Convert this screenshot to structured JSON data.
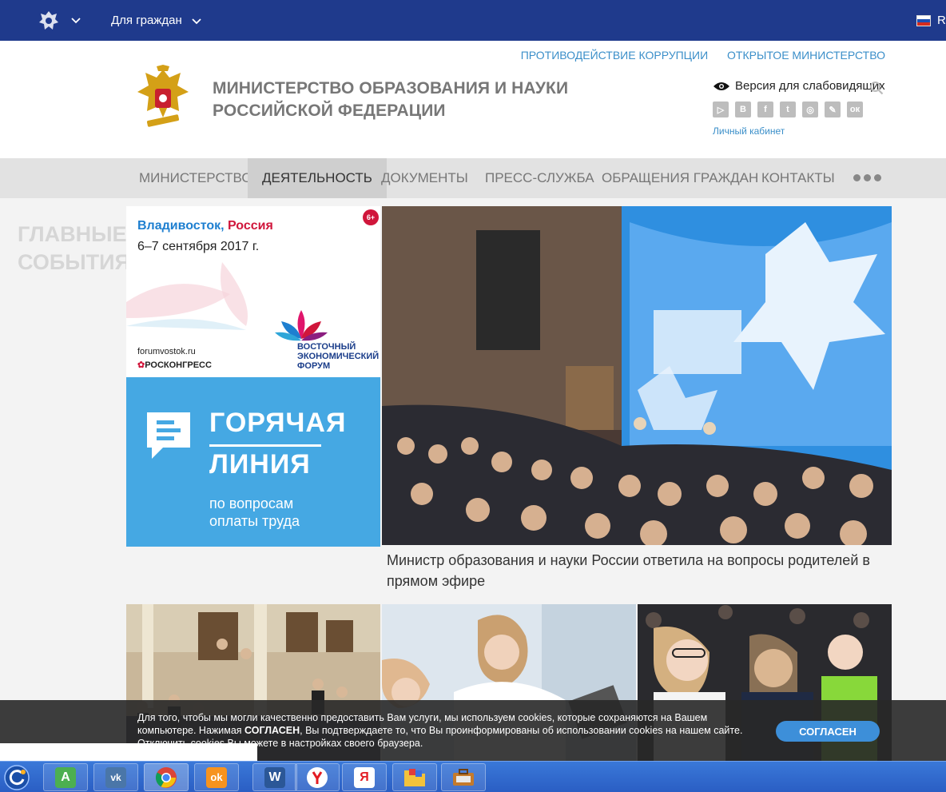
{
  "topbar": {
    "citizens_label": "Для граждан",
    "lang": "R"
  },
  "header": {
    "links": [
      "ПРОТИВОДЕЙСТВИЕ КОРРУПЦИИ",
      "ОТКРЫТОЕ МИНИСТЕРСТВО"
    ],
    "title_line1": "МИНИСТЕРСТВО ОБРАЗОВАНИЯ И НАУКИ",
    "title_line2": "РОССИЙСКОЙ ФЕДЕРАЦИИ",
    "vision_label": "Версия для слабовидящих",
    "socials": [
      "▷",
      "В",
      "f",
      "t",
      "◎",
      "✎",
      "ок"
    ],
    "cabinet_label": "Личный кабинет"
  },
  "nav": {
    "items": [
      "МИНИСТЕРСТВО",
      "ДЕЯТЕЛЬНОСТЬ",
      "ДОКУМЕНТЫ",
      "ПРЕСС-СЛУЖБА",
      "ОБРАЩЕНИЯ ГРАЖДАН",
      "КОНТАКТЫ"
    ],
    "active": "ДЕЯТЕЛЬНОСТЬ"
  },
  "side": {
    "line1": "ГЛАВНЫЕ",
    "line2": "СОБЫТИЯ"
  },
  "forum_banner": {
    "city_a": "Владивосток,",
    "city_b": "Россия",
    "dates": "6–7 сентября 2017 г.",
    "age": "6+",
    "site": "forumvostok.ru",
    "roscongress": "РОСКОНГРЕСС",
    "forum_l1": "ВОСТОЧНЫЙ",
    "forum_l2": "ЭКОНОМИЧЕСКИЙ",
    "forum_l3": "ФОРУМ"
  },
  "hotline_banner": {
    "l1": "ГОРЯЧАЯ",
    "l2": "ЛИНИЯ",
    "l3": "по вопросам",
    "l4": "оплаты труда"
  },
  "main_news": {
    "caption": "Министр образования и науки России ответила на вопросы родителей в прямом эфире"
  },
  "cookie": {
    "text_a": "Для того, чтобы мы могли качественно предоставить Вам услуги, мы используем cookies, которые сохраняются на Вашем компьютере. Нажимая ",
    "text_b": "СОГЛАСЕН",
    "text_c": ", Вы подтверждаете то, что Вы проинформированы об использовании cookies на нашем сайте. Отключить cookies Вы можете в настройках своего браузера.",
    "button": "СОГЛАСЕН"
  },
  "taskbar": {
    "apps": [
      "A",
      "vk",
      "chrome",
      "ok",
      "W",
      "Y",
      "Я",
      "folder",
      "briefcase"
    ],
    "colors": {
      "android": "#4caf50",
      "vk": "#4a76a8",
      "ok": "#f7931e",
      "word": "#2b5797",
      "yandex": "#ff0000"
    }
  }
}
